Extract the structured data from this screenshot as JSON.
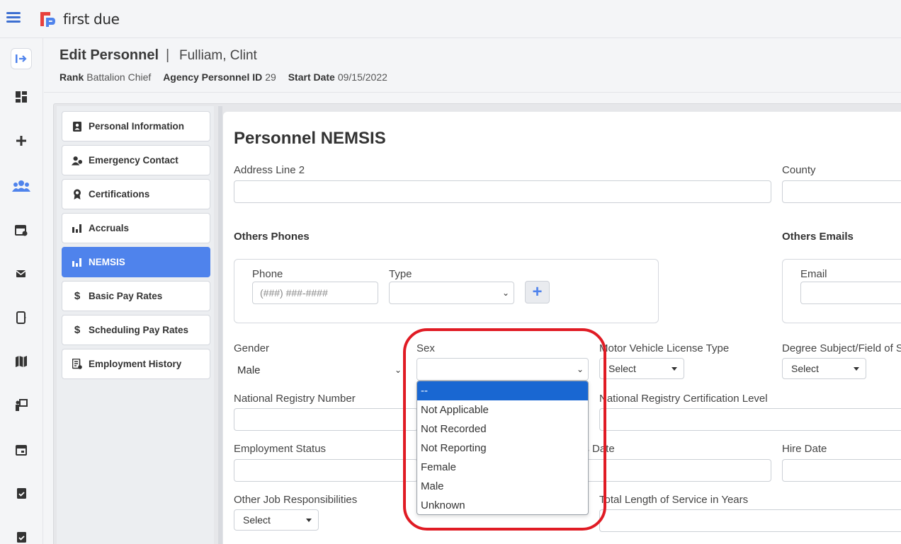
{
  "app": {
    "logo_text": "first due",
    "brand_color": "#4f83ec"
  },
  "header": {
    "title": "Edit Personnel",
    "separator": "|",
    "person_name": "Fulliam, Clint",
    "rank_label": "Rank",
    "rank_value": "Battalion Chief",
    "agency_id_label": "Agency Personnel ID",
    "agency_id_value": "29",
    "start_date_label": "Start Date",
    "start_date_value": "09/15/2022"
  },
  "left_rail": [
    "exit-icon",
    "dashboard-icon",
    "plus-icon",
    "people-icon",
    "calendar-user-icon",
    "mail-icon",
    "device-icon",
    "map-icon",
    "presentation-icon",
    "calendar-icon",
    "clipboard-check-icon",
    "clipboard-check-icon"
  ],
  "menu": [
    {
      "label": "Personal Information",
      "icon": "id-badge-icon"
    },
    {
      "label": "Emergency Contact",
      "icon": "contact-icon"
    },
    {
      "label": "Certifications",
      "icon": "award-icon"
    },
    {
      "label": "Accruals",
      "icon": "bar-chart-icon"
    },
    {
      "label": "NEMSIS",
      "icon": "bar-chart-icon",
      "active": true
    },
    {
      "label": "Basic Pay Rates",
      "icon": "dollar-icon"
    },
    {
      "label": "Scheduling Pay Rates",
      "icon": "dollar-icon"
    },
    {
      "label": "Employment History",
      "icon": "document-icon"
    }
  ],
  "form": {
    "section_title": "Personnel NEMSIS",
    "address_line2_label": "Address Line 2",
    "county_label": "County",
    "others_phones_label": "Others Phones",
    "others_emails_label": "Others Emails",
    "phone_label": "Phone",
    "phone_placeholder": "(###) ###-####",
    "type_label": "Type",
    "email_label": "Email",
    "gender_label": "Gender",
    "gender_value": "Male",
    "sex_label": "Sex",
    "mv_license_label": "Motor Vehicle License Type",
    "mv_license_value": "Select",
    "degree_label": "Degree Subject/Field of St",
    "degree_value": "Select",
    "nrn_label": "National Registry Number",
    "nrcl_label": "National Registry Certification Level",
    "employment_status_label": "Employment Status",
    "status_date_label": "us Date",
    "hire_date_label": "Hire Date",
    "other_job_label": "Other Job Responsibilities",
    "other_job_value": "Select",
    "total_service_label": "Total Length of Service in Years"
  },
  "sex_dropdown": {
    "options": [
      "--",
      "Not Applicable",
      "Not Recorded",
      "Not Reporting",
      "Female",
      "Male",
      "Unknown"
    ],
    "selected": "--"
  }
}
